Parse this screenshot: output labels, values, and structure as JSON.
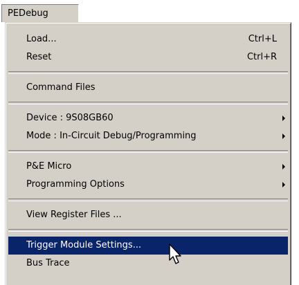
{
  "menu": {
    "title": "PEDebug",
    "items": [
      {
        "label": "Load...",
        "shortcut": "Ctrl+L"
      },
      {
        "label": "Reset",
        "shortcut": "Ctrl+R"
      },
      {
        "label": "Command Files"
      },
      {
        "label": "Device : 9S08GB60",
        "submenu": true
      },
      {
        "label": "Mode : In-Circuit Debug/Programming",
        "submenu": true
      },
      {
        "label": "P&E Micro",
        "submenu": true
      },
      {
        "label": "Programming Options",
        "submenu": true
      },
      {
        "label": "View Register Files ..."
      },
      {
        "label": "Trigger Module Settings...",
        "selected": true
      },
      {
        "label": "Bus Trace"
      }
    ]
  },
  "colors": {
    "menu_background": "#d4d0c8",
    "highlight": "#0a246a",
    "highlight_text": "#ffffff"
  },
  "icons": {
    "submenu": "right-triangle-arrow",
    "cursor": "mouse-pointer-arrow"
  }
}
